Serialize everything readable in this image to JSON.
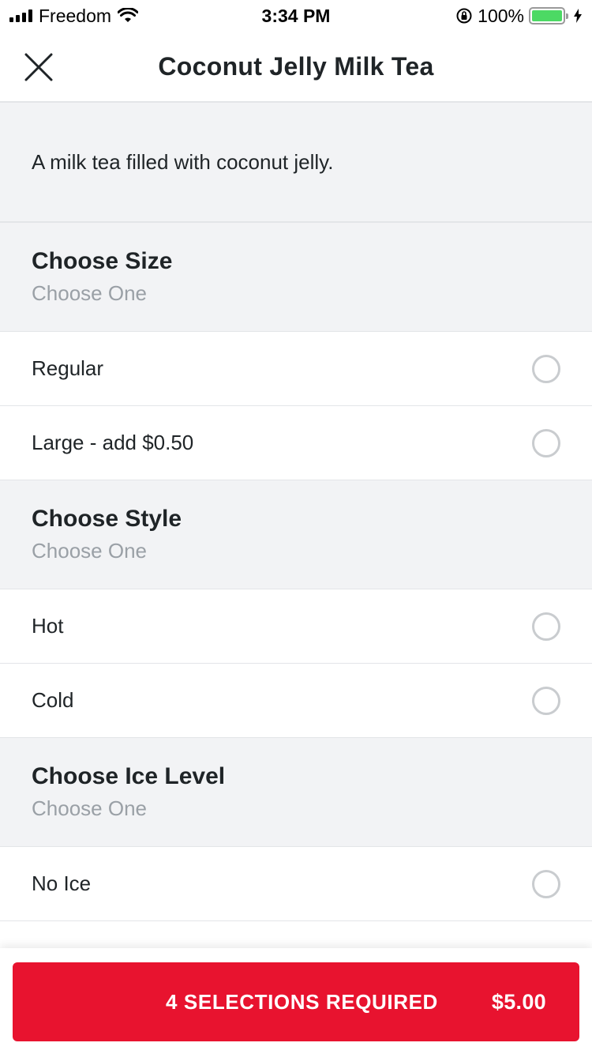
{
  "status_bar": {
    "carrier": "Freedom",
    "time": "3:34 PM",
    "battery_percent": "100%",
    "battery_color": "#4cd964"
  },
  "header": {
    "title": "Coconut Jelly Milk Tea",
    "close_icon": "close-icon"
  },
  "description": "A milk tea filled with coconut jelly.",
  "sections": [
    {
      "title": "Choose Size",
      "subtitle": "Choose One",
      "options": [
        "Regular",
        "Large - add $0.50"
      ]
    },
    {
      "title": "Choose Style",
      "subtitle": "Choose One",
      "options": [
        "Hot",
        "Cold"
      ]
    },
    {
      "title": "Choose Ice Level",
      "subtitle": "Choose One",
      "options": [
        "No Ice"
      ]
    }
  ],
  "cta": {
    "label": "4 SELECTIONS REQUIRED",
    "price": "$5.00",
    "color": "#e8132f"
  }
}
